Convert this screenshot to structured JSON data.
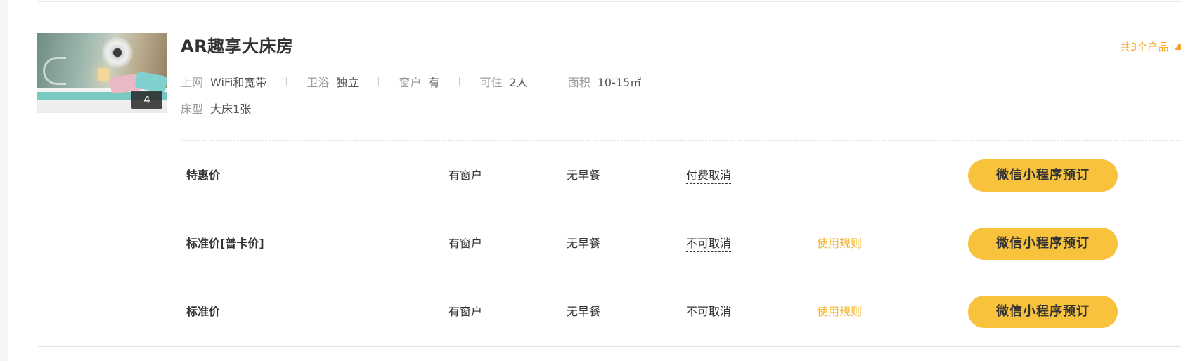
{
  "room": {
    "title": "AR趣享大床房",
    "image_count": "4",
    "product_count_label": "共3个产品",
    "specs": [
      {
        "label": "上网",
        "value": "WiFi和宽带"
      },
      {
        "label": "卫浴",
        "value": "独立"
      },
      {
        "label": "窗户",
        "value": "有"
      },
      {
        "label": "可住",
        "value": "2人"
      },
      {
        "label": "面积",
        "value": "10-15㎡"
      }
    ],
    "bed": {
      "label": "床型",
      "value": "大床1张"
    }
  },
  "rates": [
    {
      "name": "特惠价",
      "window": "有窗户",
      "meal": "无早餐",
      "cancel": "付费取消",
      "rules": "",
      "book_label": "微信小程序预订"
    },
    {
      "name": "标准价[普卡价]",
      "window": "有窗户",
      "meal": "无早餐",
      "cancel": "不可取消",
      "rules": "使用规则",
      "book_label": "微信小程序预订"
    },
    {
      "name": "标准价",
      "window": "有窗户",
      "meal": "无早餐",
      "cancel": "不可取消",
      "rules": "使用规则",
      "book_label": "微信小程序预订"
    }
  ],
  "colors": {
    "accent_orange": "#f5a623",
    "rules_yellow": "#f7b52b",
    "book_button": "#f8c23d"
  }
}
